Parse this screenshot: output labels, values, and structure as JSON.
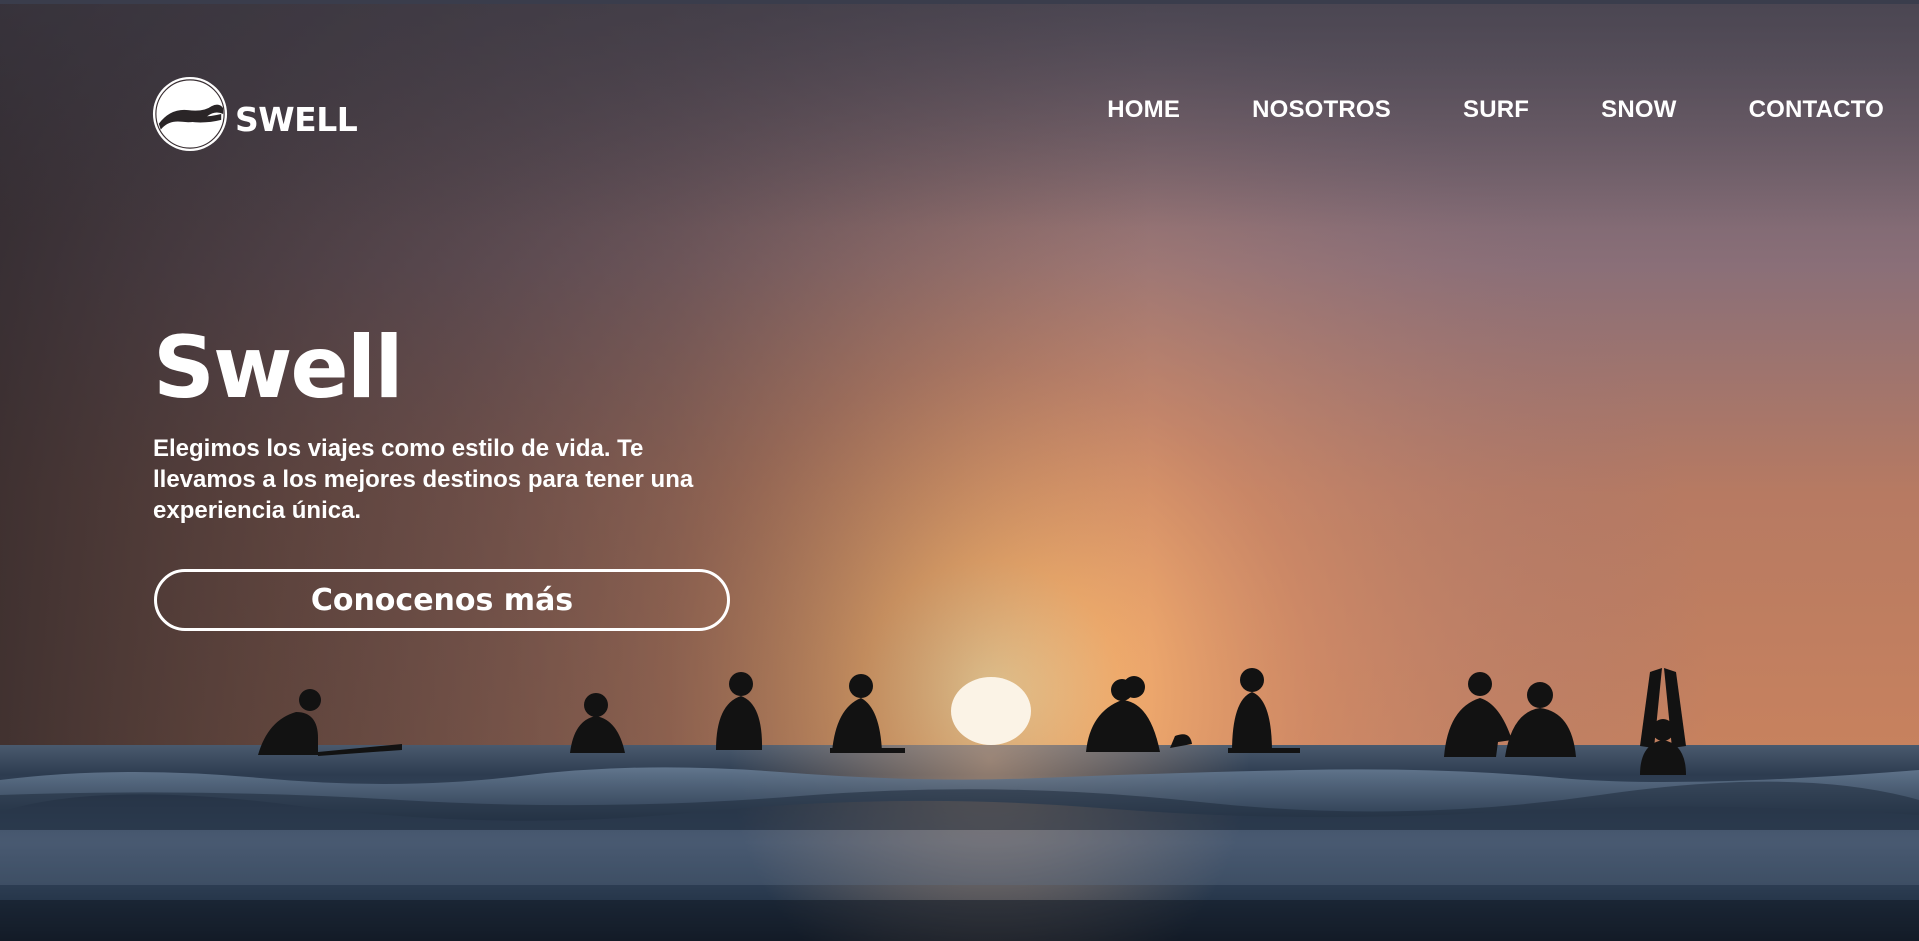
{
  "brand": {
    "name": "SWELL",
    "logo_icon": "wave-circle-logo-icon"
  },
  "nav": {
    "items": [
      {
        "label": "HOME"
      },
      {
        "label": "NOSOTROS"
      },
      {
        "label": "SURF"
      },
      {
        "label": "SNOW"
      },
      {
        "label": "CONTACTO"
      }
    ]
  },
  "hero": {
    "title": "Swell",
    "description": "Elegimos los viajes como estilo de vida. Te llevamos a los mejores destinos para tener una experiencia única.",
    "cta_label": "Conocenos más",
    "background": "sunset-surfers-ocean-photo"
  },
  "colors": {
    "text": "#ffffff",
    "sky_top": "#4a4550",
    "sun_glow": "#f6b06e",
    "ocean": "#2c3c50"
  }
}
